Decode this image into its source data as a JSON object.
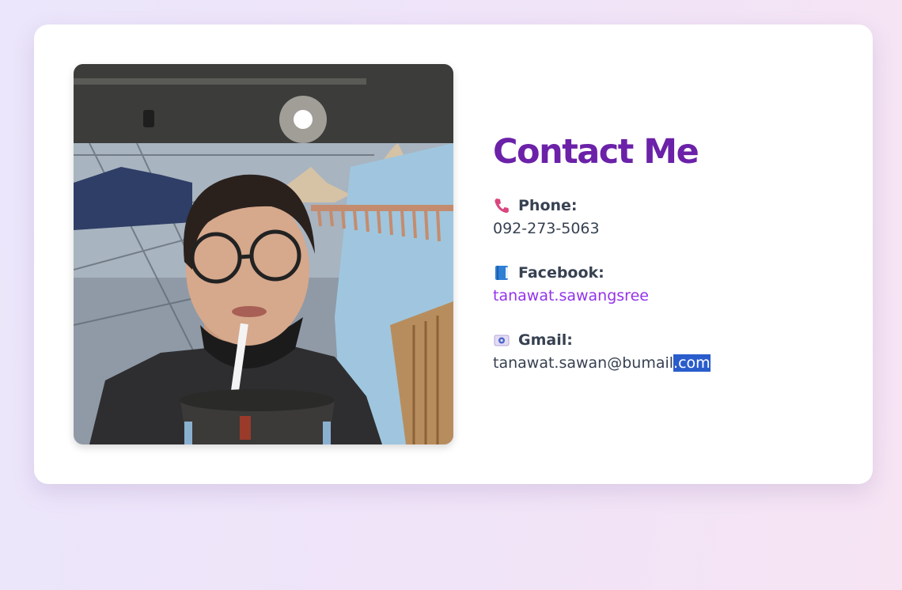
{
  "contact": {
    "title": "Contact Me",
    "photo": {
      "alt": "Profile photo"
    },
    "items": [
      {
        "icon": "phone-icon",
        "label": "Phone:",
        "value": "092-273-5063"
      },
      {
        "icon": "book-icon",
        "label": "Facebook:",
        "value": "tanawat.sawangsree"
      },
      {
        "icon": "mail-icon",
        "label": "Gmail:",
        "value_main": "tanawat.sawan@bumail",
        "value_selected": ".com"
      }
    ]
  },
  "colors": {
    "title": "#6b21a8",
    "link": "#9333ea",
    "text": "#374151",
    "selection": "#2a5dcc"
  }
}
